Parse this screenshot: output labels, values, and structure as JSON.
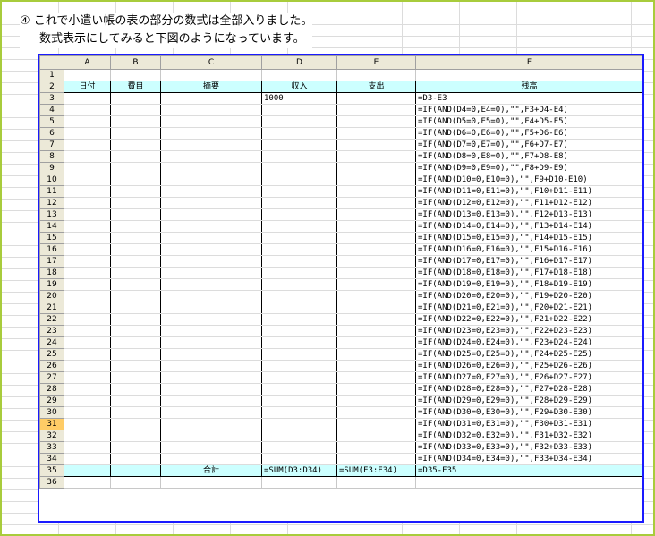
{
  "note": {
    "line1": "④ これで小遣い帳の表の部分の数式は全部入りました。",
    "line2": "数式表示にしてみると下図のようになっています。"
  },
  "columns": [
    "A",
    "B",
    "C",
    "D",
    "E",
    "F"
  ],
  "selected_row": "31",
  "header_row": {
    "num": "2",
    "cells": [
      "日付",
      "費目",
      "摘要",
      "収入",
      "支出",
      "残高"
    ]
  },
  "rows": [
    {
      "num": "1",
      "cells": [
        "",
        "",
        "",
        "",
        "",
        ""
      ]
    },
    {
      "num": "3",
      "cells": [
        "",
        "",
        "",
        "1000",
        "",
        "=D3-E3"
      ]
    },
    {
      "num": "4",
      "cells": [
        "",
        "",
        "",
        "",
        "",
        "=IF(AND(D4=0,E4=0),\"\",F3+D4-E4)"
      ]
    },
    {
      "num": "5",
      "cells": [
        "",
        "",
        "",
        "",
        "",
        "=IF(AND(D5=0,E5=0),\"\",F4+D5-E5)"
      ]
    },
    {
      "num": "6",
      "cells": [
        "",
        "",
        "",
        "",
        "",
        "=IF(AND(D6=0,E6=0),\"\",F5+D6-E6)"
      ]
    },
    {
      "num": "7",
      "cells": [
        "",
        "",
        "",
        "",
        "",
        "=IF(AND(D7=0,E7=0),\"\",F6+D7-E7)"
      ]
    },
    {
      "num": "8",
      "cells": [
        "",
        "",
        "",
        "",
        "",
        "=IF(AND(D8=0,E8=0),\"\",F7+D8-E8)"
      ]
    },
    {
      "num": "9",
      "cells": [
        "",
        "",
        "",
        "",
        "",
        "=IF(AND(D9=0,E9=0),\"\",F8+D9-E9)"
      ]
    },
    {
      "num": "10",
      "cells": [
        "",
        "",
        "",
        "",
        "",
        "=IF(AND(D10=0,E10=0),\"\",F9+D10-E10)"
      ]
    },
    {
      "num": "11",
      "cells": [
        "",
        "",
        "",
        "",
        "",
        "=IF(AND(D11=0,E11=0),\"\",F10+D11-E11)"
      ]
    },
    {
      "num": "12",
      "cells": [
        "",
        "",
        "",
        "",
        "",
        "=IF(AND(D12=0,E12=0),\"\",F11+D12-E12)"
      ]
    },
    {
      "num": "13",
      "cells": [
        "",
        "",
        "",
        "",
        "",
        "=IF(AND(D13=0,E13=0),\"\",F12+D13-E13)"
      ]
    },
    {
      "num": "14",
      "cells": [
        "",
        "",
        "",
        "",
        "",
        "=IF(AND(D14=0,E14=0),\"\",F13+D14-E14)"
      ]
    },
    {
      "num": "15",
      "cells": [
        "",
        "",
        "",
        "",
        "",
        "=IF(AND(D15=0,E15=0),\"\",F14+D15-E15)"
      ]
    },
    {
      "num": "16",
      "cells": [
        "",
        "",
        "",
        "",
        "",
        "=IF(AND(D16=0,E16=0),\"\",F15+D16-E16)"
      ]
    },
    {
      "num": "17",
      "cells": [
        "",
        "",
        "",
        "",
        "",
        "=IF(AND(D17=0,E17=0),\"\",F16+D17-E17)"
      ]
    },
    {
      "num": "18",
      "cells": [
        "",
        "",
        "",
        "",
        "",
        "=IF(AND(D18=0,E18=0),\"\",F17+D18-E18)"
      ]
    },
    {
      "num": "19",
      "cells": [
        "",
        "",
        "",
        "",
        "",
        "=IF(AND(D19=0,E19=0),\"\",F18+D19-E19)"
      ]
    },
    {
      "num": "20",
      "cells": [
        "",
        "",
        "",
        "",
        "",
        "=IF(AND(D20=0,E20=0),\"\",F19+D20-E20)"
      ]
    },
    {
      "num": "21",
      "cells": [
        "",
        "",
        "",
        "",
        "",
        "=IF(AND(D21=0,E21=0),\"\",F20+D21-E21)"
      ]
    },
    {
      "num": "22",
      "cells": [
        "",
        "",
        "",
        "",
        "",
        "=IF(AND(D22=0,E22=0),\"\",F21+D22-E22)"
      ]
    },
    {
      "num": "23",
      "cells": [
        "",
        "",
        "",
        "",
        "",
        "=IF(AND(D23=0,E23=0),\"\",F22+D23-E23)"
      ]
    },
    {
      "num": "24",
      "cells": [
        "",
        "",
        "",
        "",
        "",
        "=IF(AND(D24=0,E24=0),\"\",F23+D24-E24)"
      ]
    },
    {
      "num": "25",
      "cells": [
        "",
        "",
        "",
        "",
        "",
        "=IF(AND(D25=0,E25=0),\"\",F24+D25-E25)"
      ]
    },
    {
      "num": "26",
      "cells": [
        "",
        "",
        "",
        "",
        "",
        "=IF(AND(D26=0,E26=0),\"\",F25+D26-E26)"
      ]
    },
    {
      "num": "27",
      "cells": [
        "",
        "",
        "",
        "",
        "",
        "=IF(AND(D27=0,E27=0),\"\",F26+D27-E27)"
      ]
    },
    {
      "num": "28",
      "cells": [
        "",
        "",
        "",
        "",
        "",
        "=IF(AND(D28=0,E28=0),\"\",F27+D28-E28)"
      ]
    },
    {
      "num": "29",
      "cells": [
        "",
        "",
        "",
        "",
        "",
        "=IF(AND(D29=0,E29=0),\"\",F28+D29-E29)"
      ]
    },
    {
      "num": "30",
      "cells": [
        "",
        "",
        "",
        "",
        "",
        "=IF(AND(D30=0,E30=0),\"\",F29+D30-E30)"
      ]
    },
    {
      "num": "31",
      "cells": [
        "",
        "",
        "",
        "",
        "",
        "=IF(AND(D31=0,E31=0),\"\",F30+D31-E31)"
      ]
    },
    {
      "num": "32",
      "cells": [
        "",
        "",
        "",
        "",
        "",
        "=IF(AND(D32=0,E32=0),\"\",F31+D32-E32)"
      ]
    },
    {
      "num": "33",
      "cells": [
        "",
        "",
        "",
        "",
        "",
        "=IF(AND(D33=0,E33=0),\"\",F32+D33-E33)"
      ]
    },
    {
      "num": "34",
      "cells": [
        "",
        "",
        "",
        "",
        "",
        "=IF(AND(D34=0,E34=0),\"\",F33+D34-E34)"
      ]
    }
  ],
  "total_row": {
    "num": "35",
    "cells": [
      "",
      "",
      "合計",
      "=SUM(D3:D34)",
      "=SUM(E3:E34)",
      "=D35-E35"
    ]
  },
  "last_row": {
    "num": "36"
  }
}
